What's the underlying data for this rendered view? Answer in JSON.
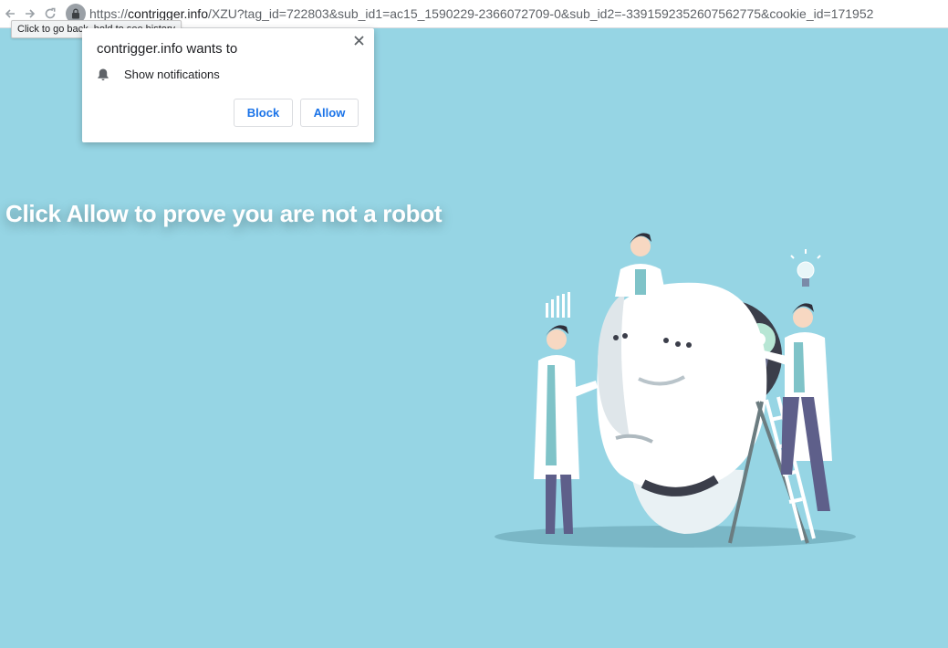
{
  "browser": {
    "url_prefix": "https://",
    "url_host": "contrigger.info",
    "url_rest": "/XZU?tag_id=722803&sub_id1=ac15_1590229-2366072709-0&sub_id2=-3391592352607562775&cookie_id=171952",
    "back_tooltip": "Click to go back, hold to see history"
  },
  "permission_popup": {
    "title": "contrigger.info wants to",
    "permission_label": "Show notifications",
    "block_label": "Block",
    "allow_label": "Allow"
  },
  "page": {
    "headline": "Click Allow to prove you are not a robot"
  },
  "colors": {
    "page_background": "#96d5e4",
    "button_text": "#1a73e8",
    "headline_text": "#ffffff"
  },
  "icons": {
    "back": "back-arrow-icon",
    "forward": "forward-arrow-icon",
    "reload": "reload-icon",
    "lock": "lock-icon",
    "close": "close-icon",
    "bell": "bell-icon"
  }
}
